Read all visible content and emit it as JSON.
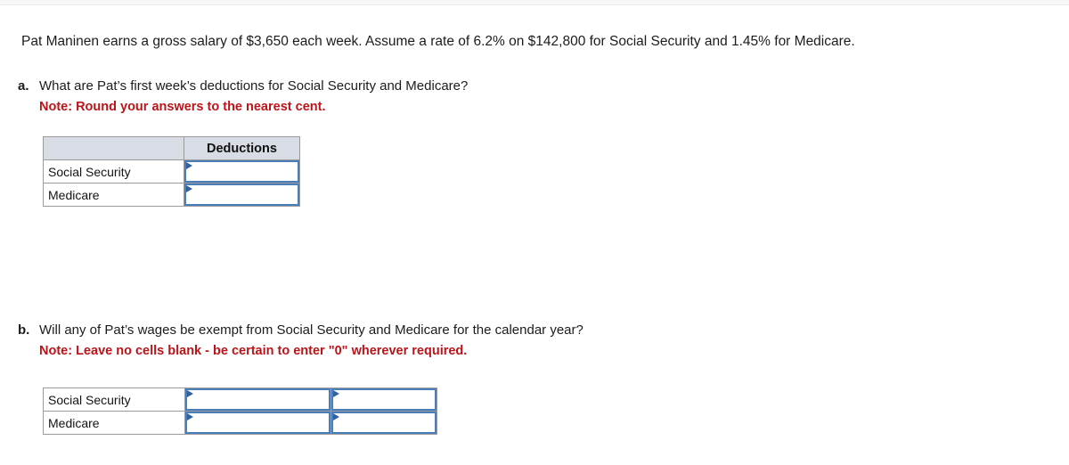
{
  "problem": {
    "statement": "Pat Maninen earns a gross salary of $3,650 each week. Assume a rate of 6.2% on $142,800 for Social Security and 1.45% for Medicare."
  },
  "parts": [
    {
      "letter": "a.",
      "question": "What are Pat’s first week’s deductions for Social Security and Medicare?",
      "note": "Note: Round your answers to the nearest cent."
    },
    {
      "letter": "b.",
      "question": "Will any of Pat’s wages be exempt from Social Security and Medicare for the calendar year?",
      "note": "Note: Leave no cells blank - be certain to enter \"0\" wherever required."
    }
  ],
  "table_a": {
    "header": {
      "blank": "",
      "deductions": "Deductions"
    },
    "rows": [
      {
        "label": "Social Security",
        "deductions_value": ""
      },
      {
        "label": "Medicare",
        "deductions_value": ""
      }
    ]
  },
  "table_b": {
    "rows": [
      {
        "label": "Social Security",
        "value_1": "",
        "value_2": ""
      },
      {
        "label": "Medicare",
        "value_1": "",
        "value_2": ""
      }
    ]
  },
  "colors": {
    "note_red": "#bb1419",
    "header_fill": "#d7dce5",
    "input_border": "#4a7ebb",
    "input_marker": "#31629f",
    "cell_border": "#9a9a9a"
  }
}
